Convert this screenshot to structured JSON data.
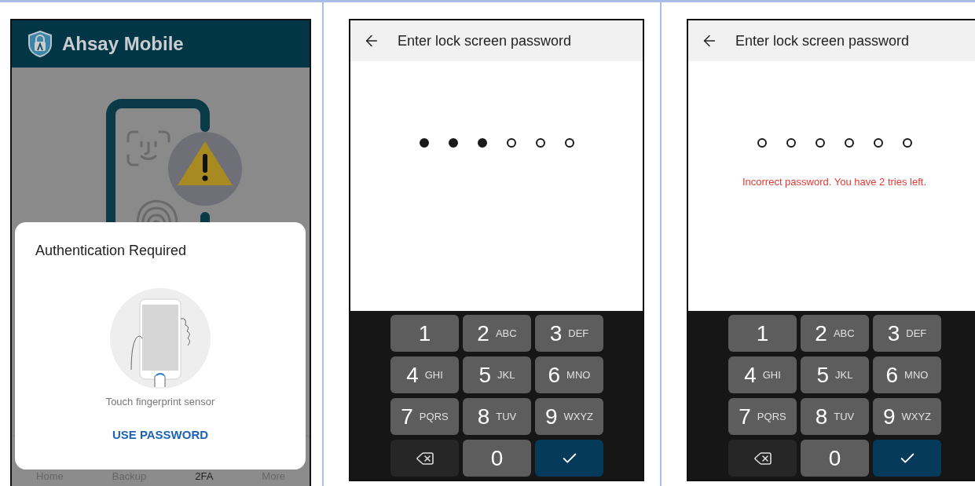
{
  "panels": [
    {
      "kind": "app",
      "app_title": "Ahsay Mobile",
      "dialog": {
        "title": "Authentication Required",
        "hint": "Touch fingerprint sensor",
        "action": "USE PASSWORD"
      },
      "nav": [
        {
          "label": "Home",
          "selected": false
        },
        {
          "label": "Backup",
          "selected": false
        },
        {
          "label": "2FA",
          "selected": true
        },
        {
          "label": "More",
          "selected": false
        }
      ]
    },
    {
      "kind": "pin",
      "title": "Enter lock screen password",
      "dots": [
        {
          "filled": true
        },
        {
          "filled": true
        },
        {
          "filled": true
        },
        {
          "filled": false
        },
        {
          "filled": false
        },
        {
          "filled": false
        }
      ],
      "keys": [
        {
          "kind": "digit",
          "digit": "1"
        },
        {
          "kind": "digit",
          "digit": "2",
          "letters": "ABC"
        },
        {
          "kind": "digit",
          "digit": "3",
          "letters": "DEF"
        },
        {
          "kind": "digit",
          "digit": "4",
          "letters": "GHI"
        },
        {
          "kind": "digit",
          "digit": "5",
          "letters": "JKL"
        },
        {
          "kind": "digit",
          "digit": "6",
          "letters": "MNO"
        },
        {
          "kind": "digit",
          "digit": "7",
          "letters": "PQRS"
        },
        {
          "kind": "digit",
          "digit": "8",
          "letters": "TUV"
        },
        {
          "kind": "digit",
          "digit": "9",
          "letters": "WXYZ"
        },
        {
          "kind": "delete"
        },
        {
          "kind": "digit",
          "digit": "0"
        },
        {
          "kind": "confirm"
        }
      ]
    },
    {
      "kind": "pin",
      "title": "Enter lock screen password",
      "dots": [
        {
          "filled": false
        },
        {
          "filled": false
        },
        {
          "filled": false
        },
        {
          "filled": false
        },
        {
          "filled": false
        },
        {
          "filled": false
        }
      ],
      "error": "Incorrect password. You have 2 tries left.",
      "keys": [
        {
          "kind": "digit",
          "digit": "1"
        },
        {
          "kind": "digit",
          "digit": "2",
          "letters": "ABC"
        },
        {
          "kind": "digit",
          "digit": "3",
          "letters": "DEF"
        },
        {
          "kind": "digit",
          "digit": "4",
          "letters": "GHI"
        },
        {
          "kind": "digit",
          "digit": "5",
          "letters": "JKL"
        },
        {
          "kind": "digit",
          "digit": "6",
          "letters": "MNO"
        },
        {
          "kind": "digit",
          "digit": "7",
          "letters": "PQRS"
        },
        {
          "kind": "digit",
          "digit": "8",
          "letters": "TUV"
        },
        {
          "kind": "digit",
          "digit": "9",
          "letters": "WXYZ"
        },
        {
          "kind": "delete"
        },
        {
          "kind": "digit",
          "digit": "0"
        },
        {
          "kind": "confirm"
        }
      ]
    }
  ]
}
